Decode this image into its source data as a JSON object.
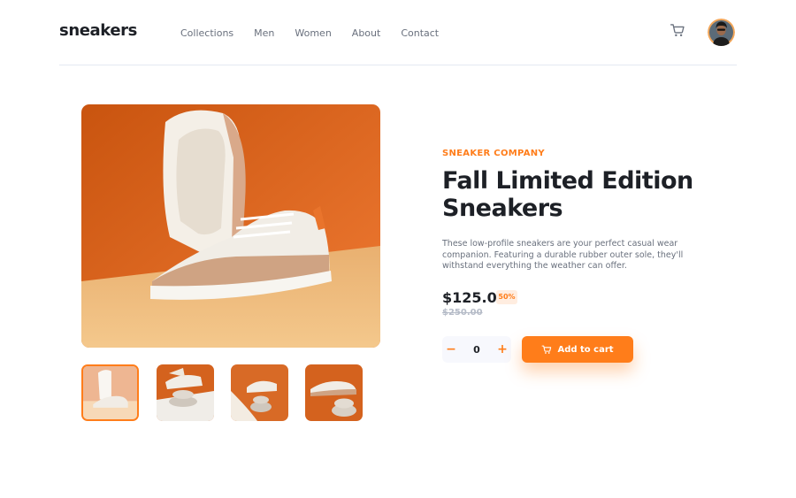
{
  "header": {
    "logo": "sneakers",
    "nav": [
      "Collections",
      "Men",
      "Women",
      "About",
      "Contact"
    ],
    "cart_icon": "cart-icon",
    "avatar_icon": "user-avatar"
  },
  "gallery": {
    "main_image": "sneaker-product-photo",
    "thumbnails": [
      "thumbnail-1",
      "thumbnail-2",
      "thumbnail-3",
      "thumbnail-4"
    ],
    "active_thumbnail": 0
  },
  "product": {
    "company": "SNEAKER COMPANY",
    "title": "Fall Limited Edition Sneakers",
    "description": "These low-profile sneakers are your perfect casual wear companion. Featuring a durable rubber outer sole, they'll withstand everything the weather can offer.",
    "price": "$125.00",
    "discount": "50%",
    "old_price": "$250.00"
  },
  "cart_controls": {
    "minus": "−",
    "quantity": "0",
    "plus": "+",
    "add_to_cart": "Add to cart"
  },
  "colors": {
    "accent": "#ff7d1a",
    "accent_pale": "#ffede0",
    "dark": "#1d2026",
    "grey": "#69707d"
  }
}
